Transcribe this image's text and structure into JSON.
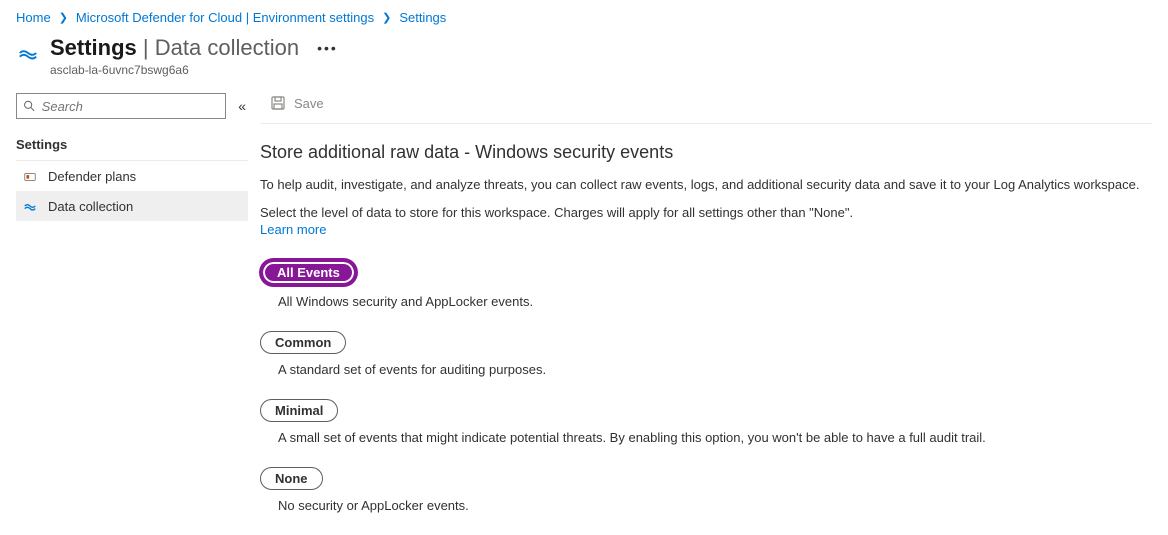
{
  "breadcrumb": {
    "home": "Home",
    "env": "Microsoft Defender for Cloud | Environment settings",
    "settings": "Settings"
  },
  "header": {
    "title": "Settings",
    "separator": " | ",
    "subtitle": "Data collection",
    "resource": "asclab-la-6uvnc7bswg6a6"
  },
  "sidebar": {
    "search_placeholder": "Search",
    "section_title": "Settings",
    "items": [
      {
        "label": "Defender plans"
      },
      {
        "label": "Data collection"
      }
    ]
  },
  "toolbar": {
    "save_label": "Save"
  },
  "main": {
    "section_title": "Store additional raw data - Windows security events",
    "desc1": "To help audit, investigate, and analyze threats, you can collect raw events, logs, and additional security data and save it to your Log Analytics workspace.",
    "desc2": "Select the level of data to store for this workspace. Charges will apply for all settings other than \"None\".",
    "learn_more": "Learn more",
    "options": [
      {
        "label": "All Events",
        "desc": "All Windows security and AppLocker events.",
        "selected": true
      },
      {
        "label": "Common",
        "desc": "A standard set of events for auditing purposes.",
        "selected": false
      },
      {
        "label": "Minimal",
        "desc": "A small set of events that might indicate potential threats. By enabling this option, you won't be able to have a full audit trail.",
        "selected": false
      },
      {
        "label": "None",
        "desc": "No security or AppLocker events.",
        "selected": false
      }
    ]
  }
}
